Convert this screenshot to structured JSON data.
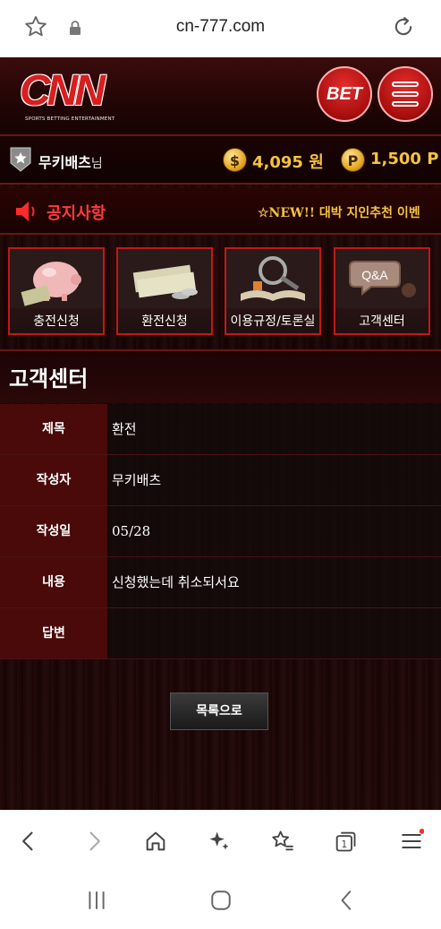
{
  "browser": {
    "url": "cn-777.com"
  },
  "site": {
    "logo_text": "CNN",
    "logo_tagline": "SPORTS BETTING ENTERTAINMENT",
    "bet_label": "BET",
    "user": {
      "name": "무키배츠",
      "suffix": "님",
      "money_symbol": "$",
      "money": "4,095 원",
      "point_symbol": "P",
      "points": "1,500 P"
    },
    "notice": {
      "title": "공지사항",
      "ticker": "☆NEW!! 대박 지인추천 이벤"
    },
    "quick_menu": [
      {
        "label": "충전신청",
        "icon": "piggy-bank-icon"
      },
      {
        "label": "환전신청",
        "icon": "cash-stack-icon"
      },
      {
        "label": "이용규정/토론실",
        "icon": "book-magnifier-icon"
      },
      {
        "label": "고객센터",
        "icon": "qa-icon"
      }
    ],
    "section_title": "고객센터",
    "detail": [
      {
        "label": "제목",
        "value": "환전"
      },
      {
        "label": "작성자",
        "value": "무키배츠"
      },
      {
        "label": "작성일",
        "value": "05/28"
      },
      {
        "label": "내용",
        "value": "신청했는데 취소되서요"
      },
      {
        "label": "답변",
        "value": ""
      }
    ],
    "list_button": "목록으로"
  },
  "colors": {
    "accent_red": "#c21818",
    "gold": "#f5c242",
    "notice_red": "#ff3b3b"
  }
}
